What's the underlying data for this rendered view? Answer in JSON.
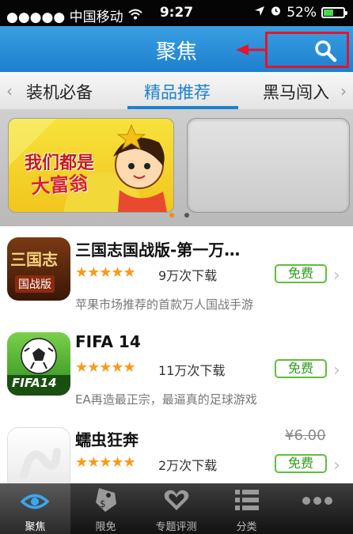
{
  "status_bar": {
    "signal": "●●●●● 中国移动",
    "time": "9:27",
    "battery": "52%",
    "battery_level": 0.52
  },
  "nav": {
    "title": "聚焦"
  },
  "tabs": [
    {
      "label": "装机必备",
      "active": false
    },
    {
      "label": "精品推荐",
      "active": true
    },
    {
      "label": "黑马闯入",
      "active": false
    }
  ],
  "banner": {
    "text_line1": "我们都是",
    "text_line2": "大富翁",
    "page_count": 2,
    "active_page": 0
  },
  "apps": [
    {
      "name": "三国志国战版-第一万…",
      "stars": "★★★★★",
      "downloads": "9万次下载",
      "price_label": "免费",
      "old_price": "",
      "description": "苹果市场推荐的首款万人国战手游",
      "icon_text": "三国志",
      "icon_sub": "国战版"
    },
    {
      "name": "FIFA 14",
      "stars": "★★★★★",
      "downloads": "11万次下载",
      "price_label": "免费",
      "old_price": "",
      "description": "EA再造最正宗，最逼真的足球游戏",
      "icon_text": "FIFA14"
    },
    {
      "name": "蠕虫狂奔",
      "stars": "★★★★★",
      "downloads": "2万次下载",
      "price_label": "免费",
      "old_price": "¥6.00",
      "description": ""
    }
  ],
  "tabbar": [
    {
      "label": "聚焦",
      "icon": "eye-icon",
      "active": true
    },
    {
      "label": "限免",
      "icon": "tag-icon",
      "active": false
    },
    {
      "label": "专题评测",
      "icon": "heart-icon",
      "active": false
    },
    {
      "label": "分类",
      "icon": "list-icon",
      "active": false
    },
    {
      "label": "",
      "icon": "more-icon",
      "active": false
    }
  ],
  "colors": {
    "nav_blue": "#1c7fcf",
    "accent_blue": "#1b82cf",
    "highlight_red": "#e2162d",
    "free_green": "#5fbf3a",
    "star_orange": "#f59b1b"
  }
}
